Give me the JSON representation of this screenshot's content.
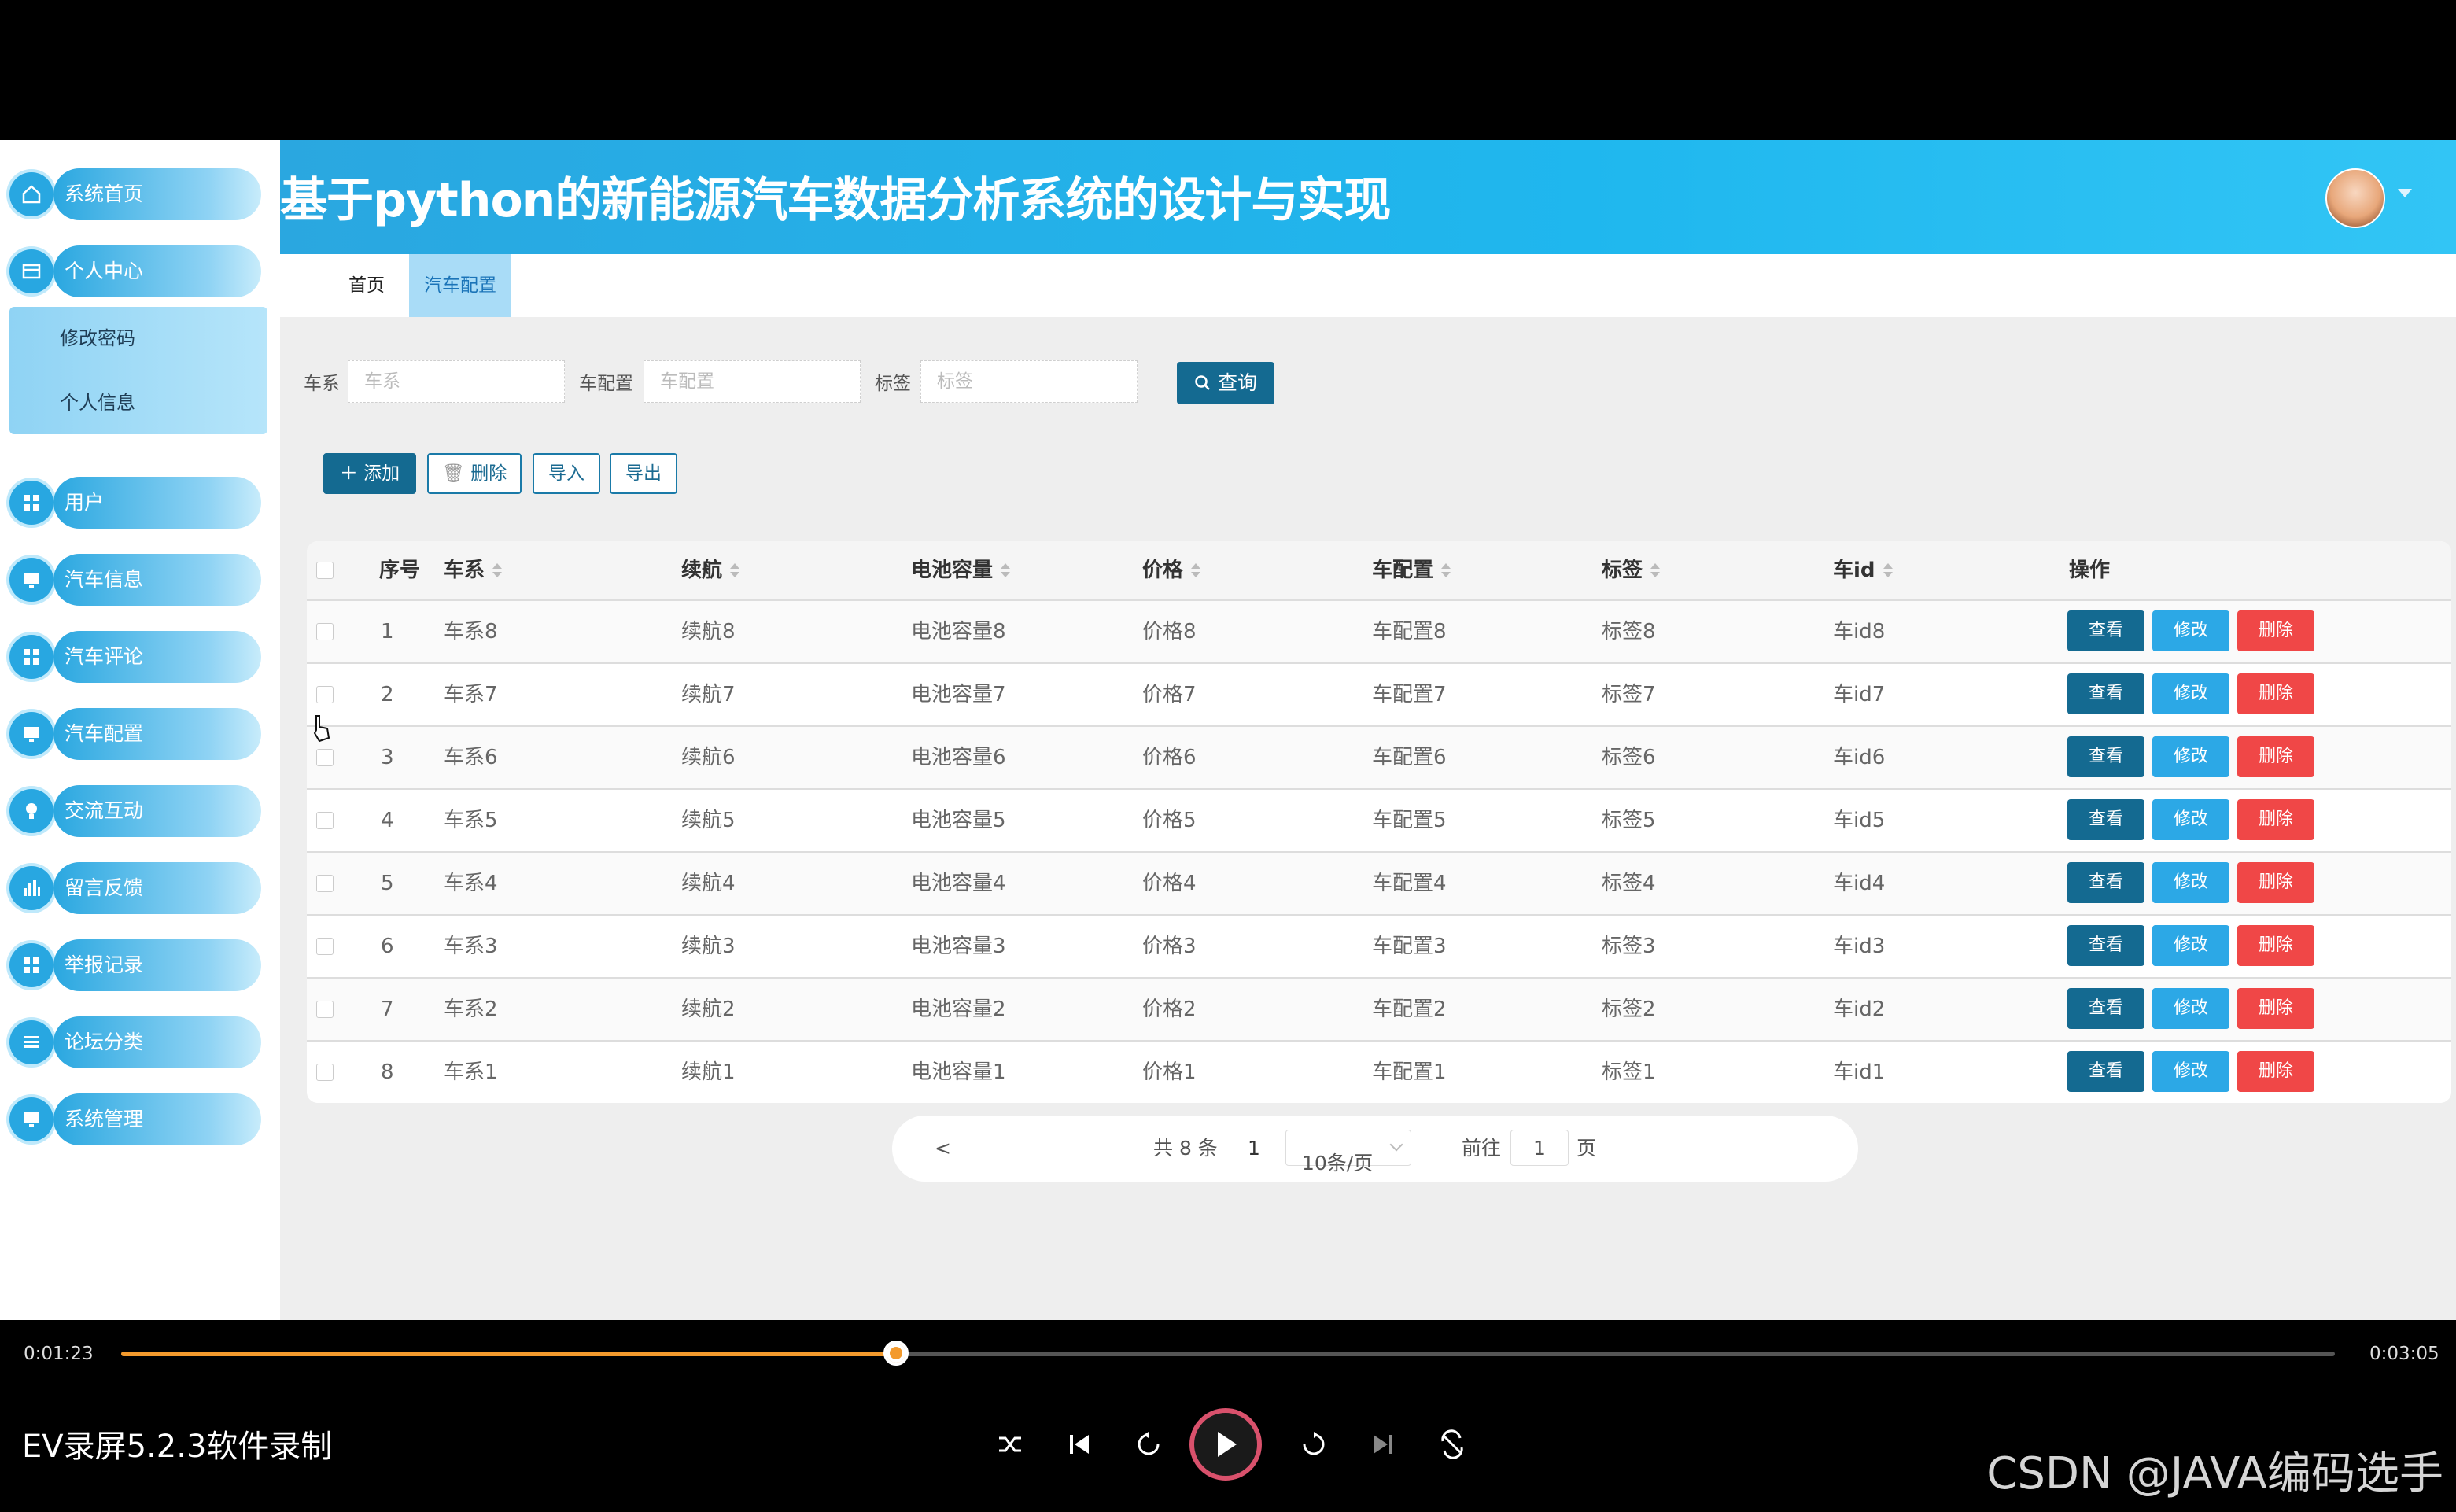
{
  "header": {
    "title": "基于python的新能源汽车数据分析系统的设计与实现"
  },
  "tabs": [
    {
      "label": "首页"
    },
    {
      "label": "汽车配置"
    }
  ],
  "sidebar": {
    "items": [
      {
        "label": "系统首页",
        "icon": "home-icon"
      },
      {
        "label": "个人中心",
        "icon": "profile-icon"
      },
      {
        "label": "用户",
        "icon": "grid-icon"
      },
      {
        "label": "汽车信息",
        "icon": "monitor-icon"
      },
      {
        "label": "汽车评论",
        "icon": "grid-icon"
      },
      {
        "label": "汽车配置",
        "icon": "monitor-icon"
      },
      {
        "label": "交流互动",
        "icon": "bulb-icon"
      },
      {
        "label": "留言反馈",
        "icon": "bar-chart-icon"
      },
      {
        "label": "举报记录",
        "icon": "grid-icon"
      },
      {
        "label": "论坛分类",
        "icon": "list-icon"
      },
      {
        "label": "系统管理",
        "icon": "monitor-icon"
      }
    ],
    "submenu": [
      {
        "label": "修改密码"
      },
      {
        "label": "个人信息"
      }
    ]
  },
  "search": {
    "fields": [
      {
        "label": "车系",
        "placeholder": "车系"
      },
      {
        "label": "车配置",
        "placeholder": "车配置"
      },
      {
        "label": "标签",
        "placeholder": "标签"
      }
    ],
    "query_label": "查询"
  },
  "actions": {
    "add": "添加",
    "delete": "删除",
    "import": "导入",
    "export": "导出"
  },
  "table": {
    "headers": {
      "index": "序号",
      "series": "车系",
      "range": "续航",
      "battery": "电池容量",
      "price": "价格",
      "config": "车配置",
      "tag": "标签",
      "car_id": "车id",
      "ops": "操作"
    },
    "op_labels": {
      "view": "查看",
      "edit": "修改",
      "delete": "删除"
    },
    "rows": [
      {
        "index": "1",
        "series": "车系8",
        "range": "续航8",
        "battery": "电池容量8",
        "price": "价格8",
        "config": "车配置8",
        "tag": "标签8",
        "car_id": "车id8"
      },
      {
        "index": "2",
        "series": "车系7",
        "range": "续航7",
        "battery": "电池容量7",
        "price": "价格7",
        "config": "车配置7",
        "tag": "标签7",
        "car_id": "车id7"
      },
      {
        "index": "3",
        "series": "车系6",
        "range": "续航6",
        "battery": "电池容量6",
        "price": "价格6",
        "config": "车配置6",
        "tag": "标签6",
        "car_id": "车id6"
      },
      {
        "index": "4",
        "series": "车系5",
        "range": "续航5",
        "battery": "电池容量5",
        "price": "价格5",
        "config": "车配置5",
        "tag": "标签5",
        "car_id": "车id5"
      },
      {
        "index": "5",
        "series": "车系4",
        "range": "续航4",
        "battery": "电池容量4",
        "price": "价格4",
        "config": "车配置4",
        "tag": "标签4",
        "car_id": "车id4"
      },
      {
        "index": "6",
        "series": "车系3",
        "range": "续航3",
        "battery": "电池容量3",
        "price": "价格3",
        "config": "车配置3",
        "tag": "标签3",
        "car_id": "车id3"
      },
      {
        "index": "7",
        "series": "车系2",
        "range": "续航2",
        "battery": "电池容量2",
        "price": "价格2",
        "config": "车配置2",
        "tag": "标签2",
        "car_id": "车id2"
      },
      {
        "index": "8",
        "series": "车系1",
        "range": "续航1",
        "battery": "电池容量1",
        "price": "价格1",
        "config": "车配置1",
        "tag": "标签1",
        "car_id": "车id1"
      }
    ]
  },
  "pagination": {
    "prev": "<",
    "total": "共 8 条",
    "current": "1",
    "page_size": "10条/页",
    "goto_label": "前往",
    "goto_value": "1",
    "page_suffix": "页"
  },
  "player": {
    "current_time": "0:01:23",
    "duration": "0:03:05",
    "progress": 0.35,
    "app_label": "EV录屏5.2.3软件录制",
    "watermark": "CSDN @JAVA编码选手"
  },
  "colors": {
    "header": "#2aa7e0",
    "primary": "#146a91",
    "edit": "#2ca8e6",
    "danger": "#f04747",
    "progress": "#f39a2d"
  }
}
